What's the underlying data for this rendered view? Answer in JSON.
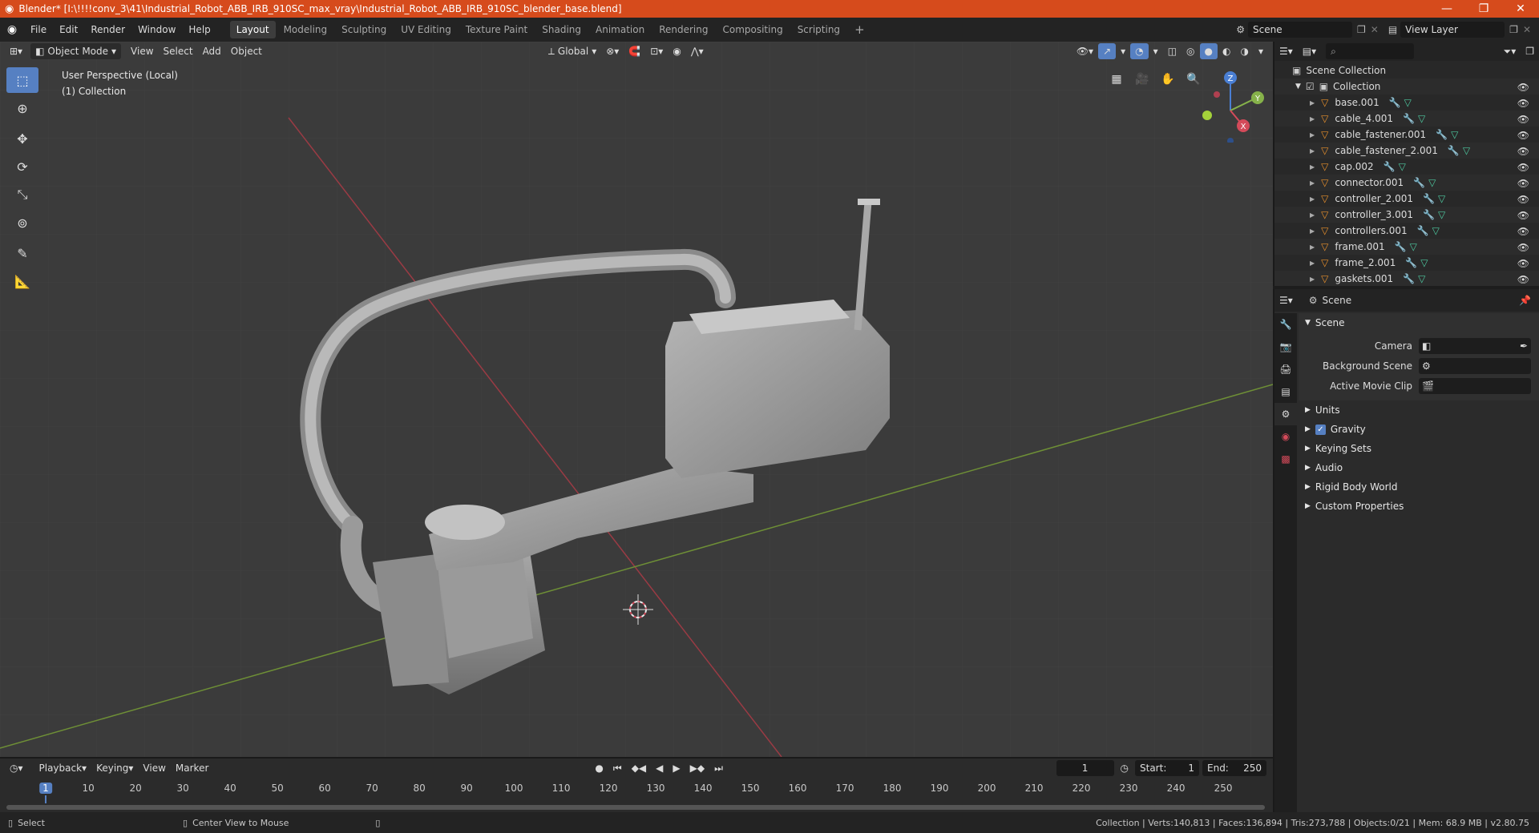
{
  "window": {
    "title": "Blender* [I:\\!!!!conv_3\\41\\Industrial_Robot_ABB_IRB_910SC_max_vray\\Industrial_Robot_ABB_IRB_910SC_blender_base.blend]",
    "minimize": "—",
    "maximize": "❐",
    "close": "✕"
  },
  "menu": {
    "items": [
      "File",
      "Edit",
      "Render",
      "Window",
      "Help"
    ]
  },
  "workspaces": [
    "Layout",
    "Modeling",
    "Sculpting",
    "UV Editing",
    "Texture Paint",
    "Shading",
    "Animation",
    "Rendering",
    "Compositing",
    "Scripting"
  ],
  "workspace_add": "+",
  "scene_field": "Scene",
  "view_layer_field": "View Layer",
  "viewport": {
    "mode": "Object Mode",
    "menus": [
      "View",
      "Select",
      "Add",
      "Object"
    ],
    "transform_orientation": "Global",
    "info_line1": "User Perspective (Local)",
    "info_line2": "(1) Collection",
    "gizmo": {
      "z": "Z",
      "y": "Y",
      "x": "X"
    }
  },
  "outliner": {
    "search_placeholder": "",
    "scene_collection": "Scene Collection",
    "collection": "Collection",
    "objects": [
      "base.001",
      "cable_4.001",
      "cable_fastener.001",
      "cable_fastener_2.001",
      "cap.002",
      "connector.001",
      "controller_2.001",
      "controller_3.001",
      "controllers.001",
      "frame.001",
      "frame_2.001",
      "gaskets.001"
    ]
  },
  "properties": {
    "breadcrumb": "Scene",
    "panel_scene": "Scene",
    "camera_label": "Camera",
    "background_scene_label": "Background Scene",
    "active_movie_clip_label": "Active Movie Clip",
    "subpanels": [
      "Units",
      "Gravity",
      "Keying Sets",
      "Audio",
      "Rigid Body World",
      "Custom Properties"
    ],
    "gravity_checked": true
  },
  "timeline": {
    "menus": [
      "Playback",
      "Keying",
      "View",
      "Marker"
    ],
    "current_frame": "1",
    "start_label": "Start:",
    "start_value": "1",
    "end_label": "End:",
    "end_value": "250",
    "ticks": [
      "1",
      "10",
      "20",
      "30",
      "40",
      "50",
      "60",
      "70",
      "80",
      "90",
      "100",
      "110",
      "120",
      "130",
      "140",
      "150",
      "160",
      "170",
      "180",
      "190",
      "200",
      "210",
      "220",
      "230",
      "240",
      "250"
    ]
  },
  "statusbar": {
    "select": "Select",
    "center_view": "Center View to Mouse",
    "stats": "Collection | Verts:140,813 | Faces:136,894 | Tris:273,788 | Objects:0/21 | Mem: 68.9 MB | v2.80.75"
  },
  "colors": {
    "title_bar": "#d64b1c",
    "accent": "#5680c2",
    "object_orange": "#e8902c",
    "x_axis": "#d44a5a",
    "y_axis": "#86b24a",
    "z_axis": "#4a7fd4"
  }
}
